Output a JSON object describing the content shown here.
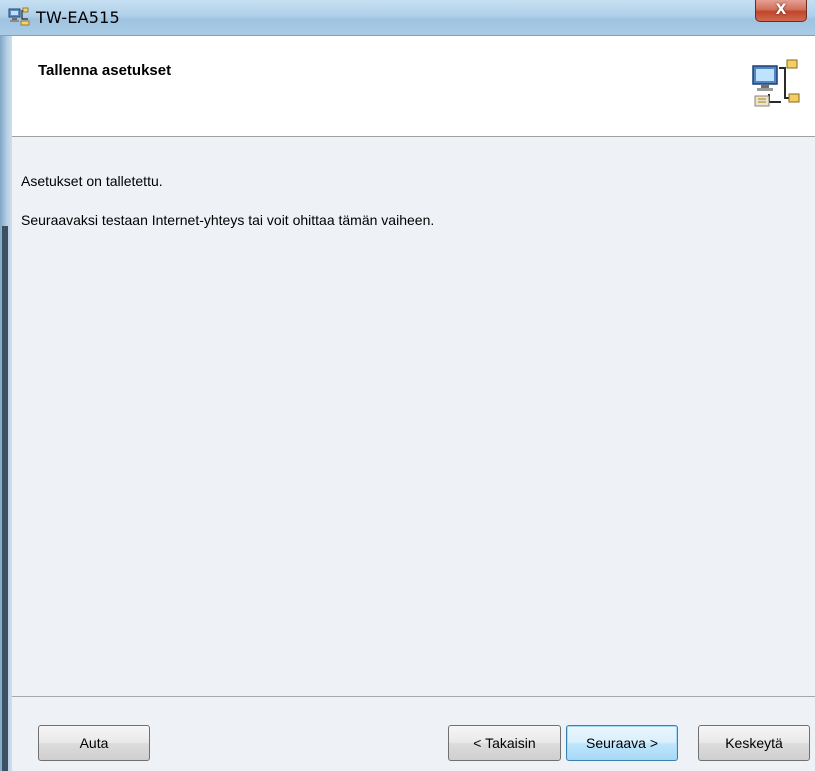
{
  "window": {
    "title": "TW-EA515",
    "close_label": "X"
  },
  "header": {
    "title": "Tallenna asetukset",
    "icon": "network-computer-icon"
  },
  "content": {
    "line1": "Asetukset on talletettu.",
    "line2": "Seuraavaksi testaan Internet-yhteys tai voit ohittaa tämän vaiheen."
  },
  "buttons": {
    "help": "Auta",
    "back": "< Takaisin",
    "next": "Seuraava >",
    "cancel": "Keskeytä"
  },
  "colors": {
    "titlebar": "#b0d0ea",
    "close": "#c1452b",
    "body": "#eef2f7",
    "default_button_border": "#3c7fb1"
  }
}
